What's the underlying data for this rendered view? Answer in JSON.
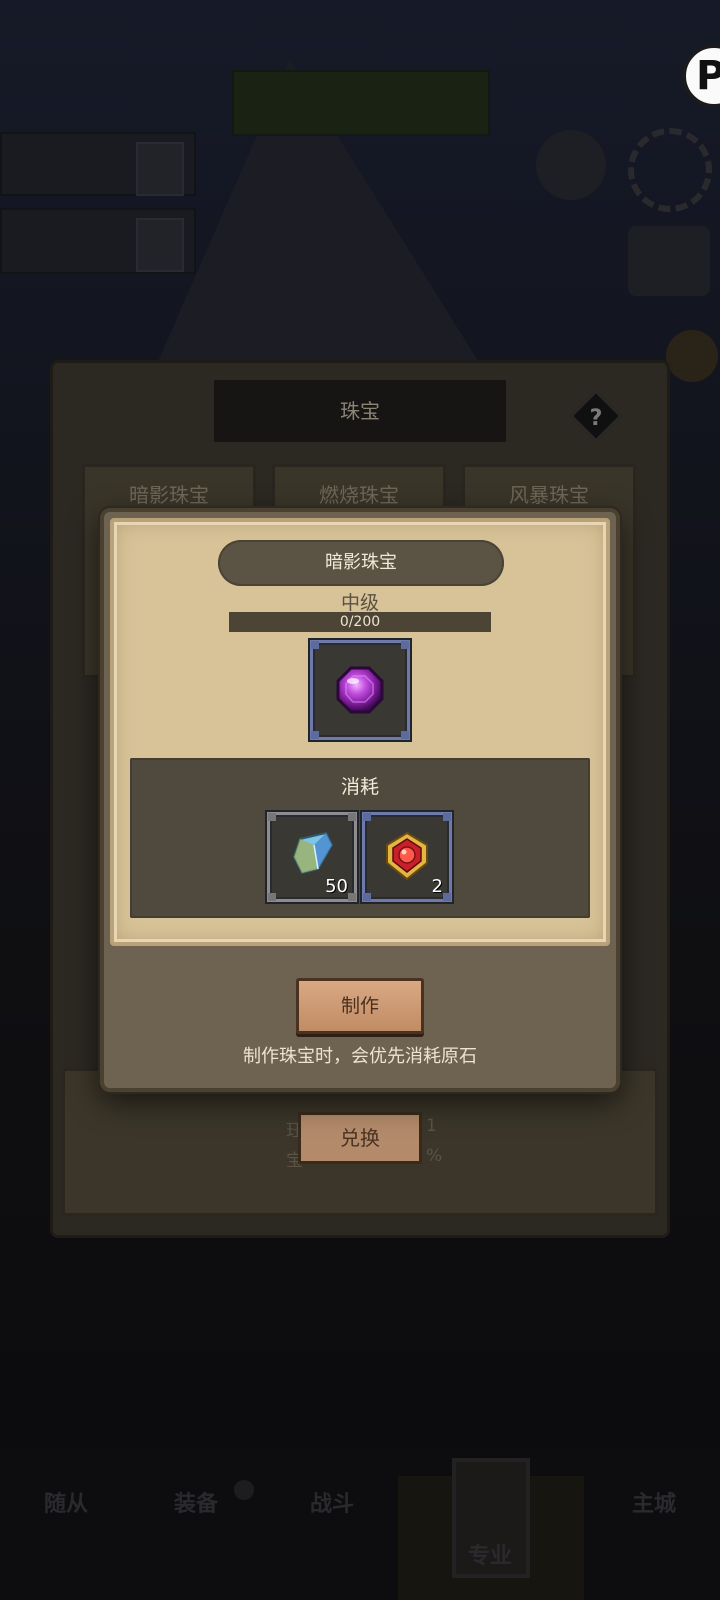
{
  "background": {
    "title_banner_text": "",
    "quest_cards": [
      "",
      ""
    ],
    "side_labels": [
      "",
      ""
    ],
    "nav_items": [
      "随从",
      "装备",
      "战斗",
      "专业",
      "主城"
    ]
  },
  "jewelry_panel": {
    "header": "珠宝",
    "help_label": "?",
    "tabs": [
      "暗影珠宝",
      "燃烧珠宝",
      "风暴珠宝"
    ],
    "exchange_button": "兑换",
    "lower_fragments": [
      "珏",
      "宝",
      "1",
      "%"
    ]
  },
  "modal": {
    "gem_title": "暗影珠宝",
    "level": "中级",
    "progress": {
      "text": "0/200",
      "current": 0,
      "max": 200
    },
    "cost_title": "消耗",
    "costs": [
      {
        "icon": "blue-crystal-icon",
        "qty": "50"
      },
      {
        "icon": "red-gold-amulet-icon",
        "qty": "2"
      }
    ],
    "make_button": "制作",
    "hint": "制作珠宝时，会优先消耗原石"
  },
  "colors": {
    "parchment": "#d8c399",
    "panel_brown": "#6e6350",
    "button_tan": "#c08c66",
    "slot_blue_border": "#6e7aa8",
    "gem_purple": "#9b2fb8"
  }
}
